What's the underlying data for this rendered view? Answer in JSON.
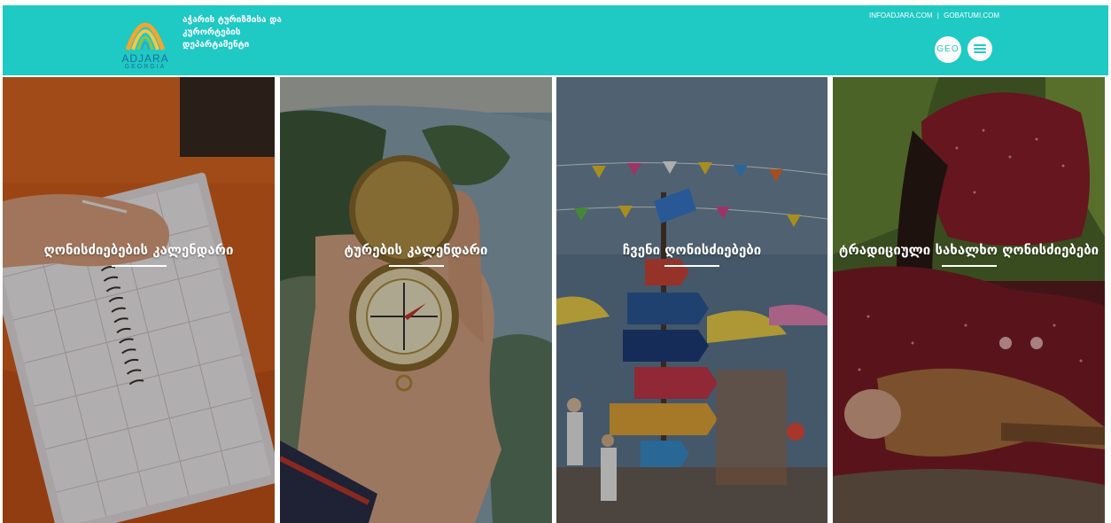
{
  "header": {
    "logo": {
      "icon": "adjara-arch-logo-icon",
      "text": "ADJARA",
      "subtext": "GEORGIA"
    },
    "org_name": "აჭარის ტურიზმისა და კურორტების დეპარტამენტი",
    "links": {
      "link1": "INFOADJARA.COM",
      "separator": "|",
      "link2": "GOBATUMI.COM"
    },
    "lang_button": "GEO",
    "menu_icon": "hamburger-menu-icon",
    "background_color": "#1fc9c4"
  },
  "panels": [
    {
      "title": "ღონისძიებების კალენდარი",
      "image": "planner-notebook-photo"
    },
    {
      "title": "ტურების კალენდარი",
      "image": "compass-in-hand-photo"
    },
    {
      "title": "ჩვენი ღონისძიებები",
      "image": "festival-signpost-photo"
    },
    {
      "title": "ტრადიციული სახალხო ღონისძიებები",
      "image": "traditional-instrument-photo"
    }
  ]
}
